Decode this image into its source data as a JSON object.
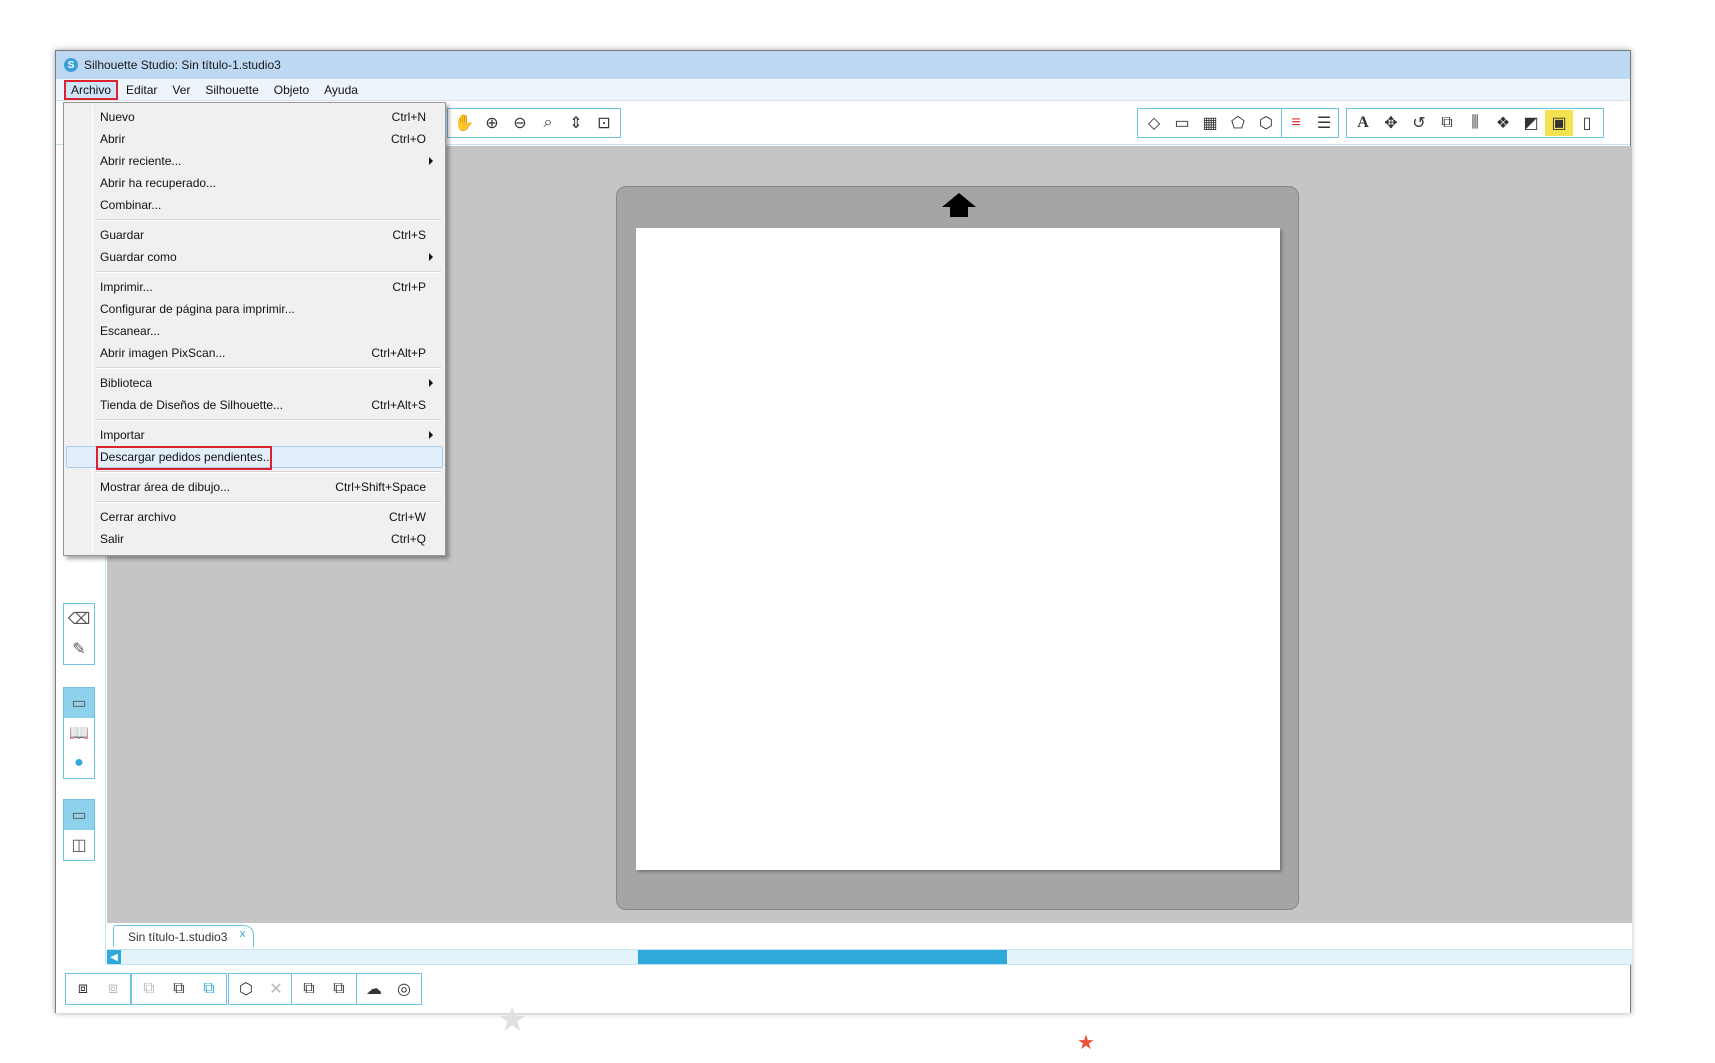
{
  "window": {
    "title": "Silhouette Studio: Sin título-1.studio3",
    "app_icon": "S"
  },
  "menubar": [
    "Archivo",
    "Editar",
    "Ver",
    "Silhouette",
    "Objeto",
    "Ayuda"
  ],
  "file_menu": {
    "items": [
      {
        "label": "Nuevo",
        "shortcut": "Ctrl+N"
      },
      {
        "label": "Abrir",
        "shortcut": "Ctrl+O"
      },
      {
        "label": "Abrir reciente...",
        "shortcut": ""
      },
      {
        "label": "Abrir ha recuperado...",
        "shortcut": ""
      },
      {
        "label": "Combinar...",
        "shortcut": ""
      },
      {
        "label": "Guardar",
        "shortcut": "Ctrl+S"
      },
      {
        "label": "Guardar como",
        "shortcut": ""
      },
      {
        "label": "Imprimir...",
        "shortcut": "Ctrl+P"
      },
      {
        "label": "Configurar de página para imprimir...",
        "shortcut": ""
      },
      {
        "label": "Escanear...",
        "shortcut": ""
      },
      {
        "label": "Abrir imagen PixScan...",
        "shortcut": "Ctrl+Alt+P"
      },
      {
        "label": "Biblioteca",
        "shortcut": ""
      },
      {
        "label": "Tienda de Diseños de Silhouette...",
        "shortcut": "Ctrl+Alt+S"
      },
      {
        "label": "Importar",
        "shortcut": ""
      },
      {
        "label": "Descargar pedidos pendientes...",
        "shortcut": ""
      },
      {
        "label": "Mostrar área de dibujo...",
        "shortcut": "Ctrl+Shift+Space"
      },
      {
        "label": "Cerrar archivo",
        "shortcut": "Ctrl+W"
      },
      {
        "label": "Salir",
        "shortcut": "Ctrl+Q"
      }
    ]
  },
  "document_tab": {
    "label": "Sin título-1.studio3",
    "close": "x"
  },
  "colors": {
    "accent": "#2fa9dc",
    "highlight_box": "#d9232d",
    "canvas_bg": "#c5c5c5",
    "mat": "#a5a5a5"
  }
}
